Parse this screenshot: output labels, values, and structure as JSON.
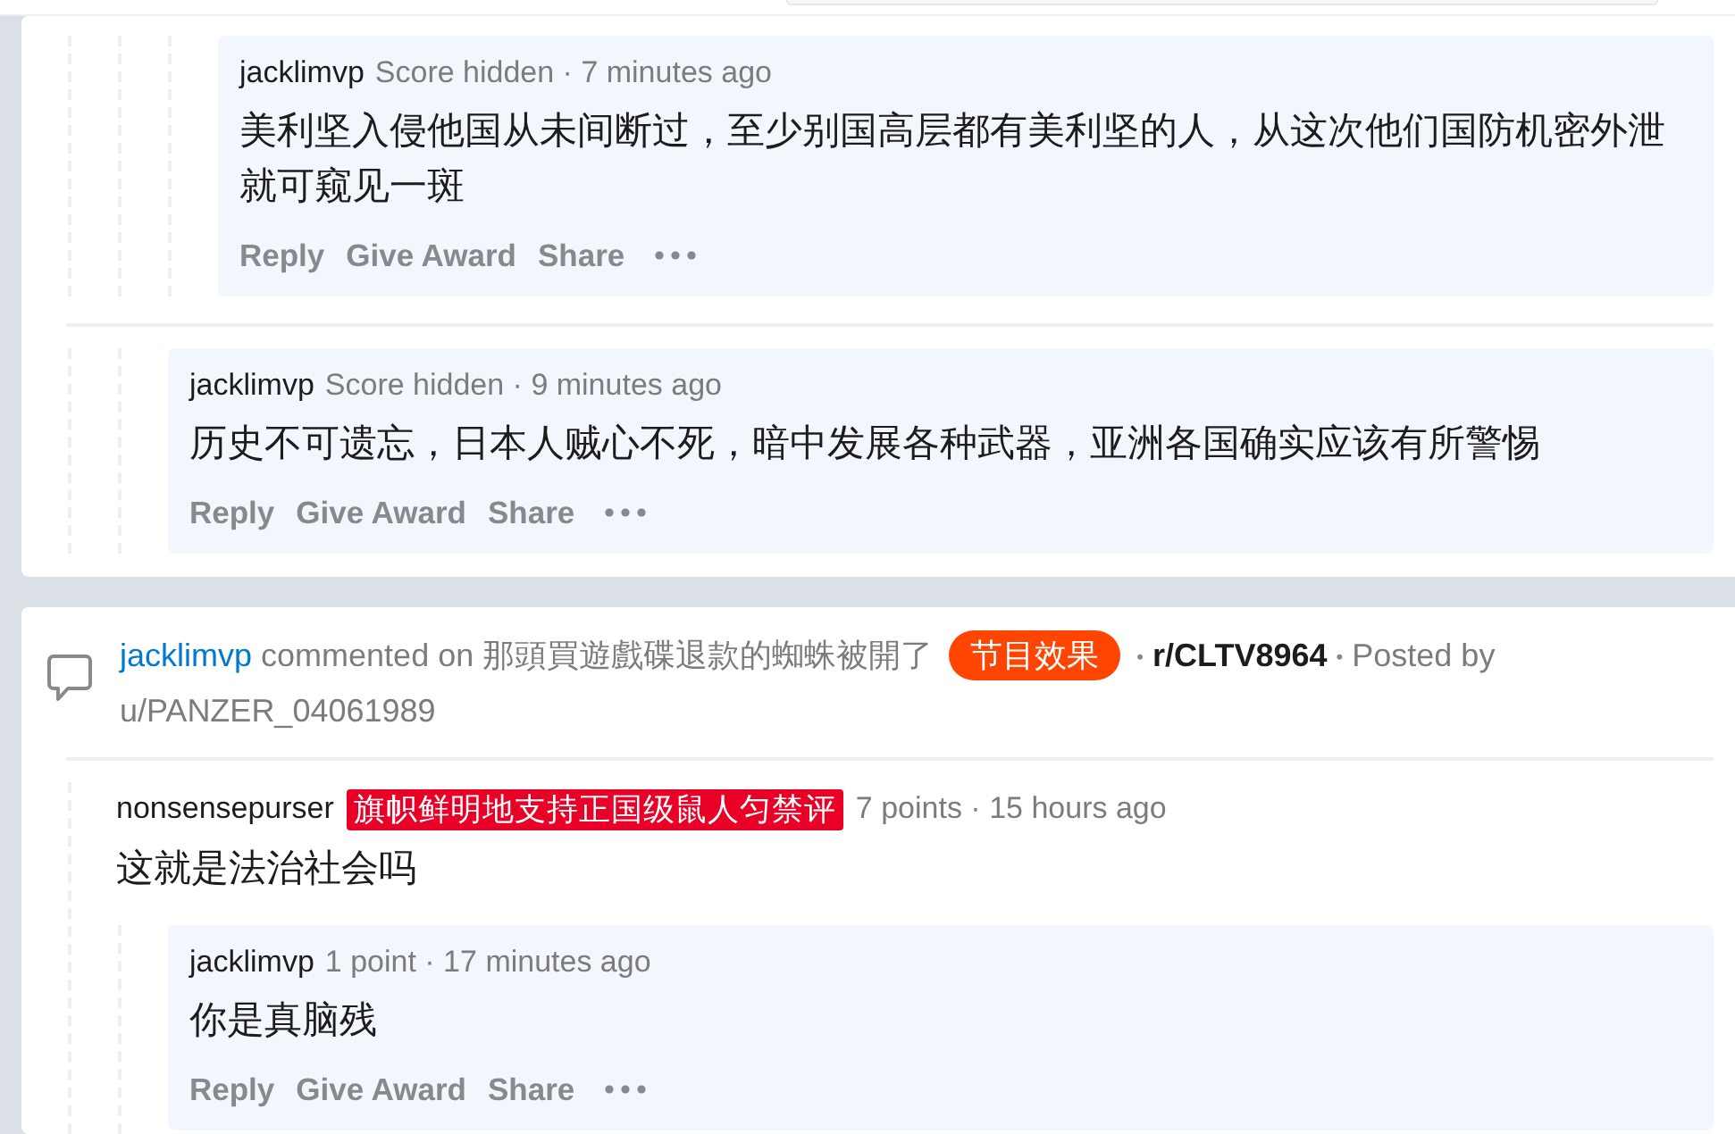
{
  "cards": [
    {
      "threads": [
        {
          "comments": [
            {
              "children": [
                {
                  "children": [
                    {
                      "author": "jacklimvp",
                      "meta": "Score hidden · 7 minutes ago",
                      "body": "美利坚入侵他国从未间断过，至少别国高层都有美利坚的人，从这次他们国防机密外泄就可窥见一斑",
                      "highlighted": true,
                      "actions": [
                        "Reply",
                        "Give Award",
                        "Share"
                      ]
                    }
                  ]
                }
              ]
            }
          ]
        },
        {
          "comments": [
            {
              "children": [
                {
                  "author": "jacklimvp",
                  "meta": "Score hidden · 9 minutes ago",
                  "body": "历史不可遗忘，日本人贼心不死，暗中发展各种武器，亚洲各国确实应该有所警惕",
                  "highlighted": true,
                  "actions": [
                    "Reply",
                    "Give Award",
                    "Share"
                  ]
                }
              ]
            }
          ]
        }
      ]
    },
    {
      "header": {
        "items": [
          {
            "kind": "commenter",
            "text": "jacklimvp"
          },
          {
            "kind": "text",
            "text": "commented on"
          },
          {
            "kind": "title",
            "text": "那頭買遊戲碟退款的蜘蛛被開了"
          },
          {
            "kind": "flair",
            "text": "节目效果",
            "color": "#ff4500"
          },
          {
            "kind": "separator",
            "text": "•"
          },
          {
            "kind": "subreddit",
            "text": "r/CLTV8964"
          },
          {
            "kind": "separator",
            "text": "•"
          },
          {
            "kind": "text",
            "text": "Posted by"
          },
          {
            "kind": "poster",
            "text": "u/PANZER_04061989"
          }
        ]
      },
      "threads": [
        {
          "comments": [
            {
              "author": "nonsensepurser",
              "flair": {
                "text": "旗帜鲜明地支持正国级鼠人匀禁评",
                "color": "#ea0027"
              },
              "meta": "7 points · 15 hours ago",
              "body": "这就是法治社会吗",
              "highlighted": false,
              "children": [
                {
                  "author": "jacklimvp",
                  "meta": "1 point · 17 minutes ago",
                  "body": "你是真脑残",
                  "highlighted": true,
                  "actions": [
                    "Reply",
                    "Give Award",
                    "Share"
                  ]
                }
              ]
            }
          ]
        }
      ]
    }
  ]
}
